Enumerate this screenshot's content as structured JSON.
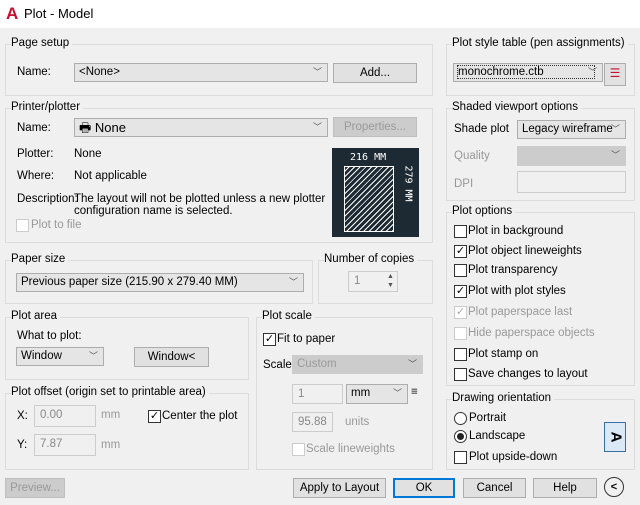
{
  "window": {
    "title": "Plot - Model",
    "app_icon": "autocad-logo-icon",
    "accent": "#c8102e"
  },
  "page_setup": {
    "group": "Page setup",
    "name_label": "Name:",
    "name_value": "<None>",
    "add_button": "Add..."
  },
  "printer": {
    "group": "Printer/plotter",
    "name_label": "Name:",
    "name_value": "None",
    "properties_button": "Properties...",
    "plotter_label": "Plotter:",
    "plotter_value": "None",
    "where_label": "Where:",
    "where_value": "Not applicable",
    "description_label": "Description:",
    "description_line1": "The layout will not be plotted unless a new plotter",
    "description_line2": "configuration name is selected.",
    "plot_to_file": "Plot to file",
    "plot_to_file_checked": false,
    "preview_width": "216 MM",
    "preview_height": "279 MM"
  },
  "paper_size": {
    "group": "Paper size",
    "value": "Previous paper size (215.90 x 279.40 MM)"
  },
  "copies": {
    "group": "Number of copies",
    "value": "1"
  },
  "plot_area": {
    "group": "Plot area",
    "what_label": "What to plot:",
    "what_value": "Window",
    "window_button": "Window<"
  },
  "plot_offset": {
    "group": "Plot offset (origin set to printable area)",
    "x_label": "X:",
    "x_value": "0.00",
    "y_label": "Y:",
    "y_value": "7.87",
    "unit": "mm",
    "center_label": "Center the plot",
    "center_checked": true
  },
  "plot_scale": {
    "group": "Plot scale",
    "fit_label": "Fit to paper",
    "fit_checked": true,
    "scale_label": "Scale:",
    "scale_value": "Custom",
    "value1": "1",
    "unit1": "mm",
    "equals": "≡",
    "value2": "95.88",
    "unit2": "units",
    "lineweights_label": "Scale lineweights",
    "lineweights_checked": false
  },
  "plot_style": {
    "group": "Plot style table (pen assignments)",
    "value": "monochrome.ctb"
  },
  "shaded": {
    "group": "Shaded viewport options",
    "shade_label": "Shade plot",
    "shade_value": "Legacy wireframe",
    "quality_label": "Quality",
    "dpi_label": "DPI"
  },
  "plot_options": {
    "group": "Plot options",
    "items": [
      {
        "label": "Plot in background",
        "checked": false,
        "enabled": true
      },
      {
        "label": "Plot object lineweights",
        "checked": true,
        "enabled": true
      },
      {
        "label": "Plot transparency",
        "checked": false,
        "enabled": true
      },
      {
        "label": "Plot with plot styles",
        "checked": true,
        "enabled": true
      },
      {
        "label": "Plot paperspace last",
        "checked": true,
        "enabled": false
      },
      {
        "label": "Hide paperspace objects",
        "checked": false,
        "enabled": false
      },
      {
        "label": "Plot stamp on",
        "checked": false,
        "enabled": true
      },
      {
        "label": "Save changes to layout",
        "checked": false,
        "enabled": true
      }
    ]
  },
  "orientation": {
    "group": "Drawing orientation",
    "portrait": "Portrait",
    "landscape": "Landscape",
    "selected": "Landscape",
    "upside_down": "Plot upside-down",
    "upside_down_checked": false
  },
  "footer": {
    "preview": "Preview...",
    "apply": "Apply to Layout",
    "ok": "OK",
    "cancel": "Cancel",
    "help": "Help"
  }
}
